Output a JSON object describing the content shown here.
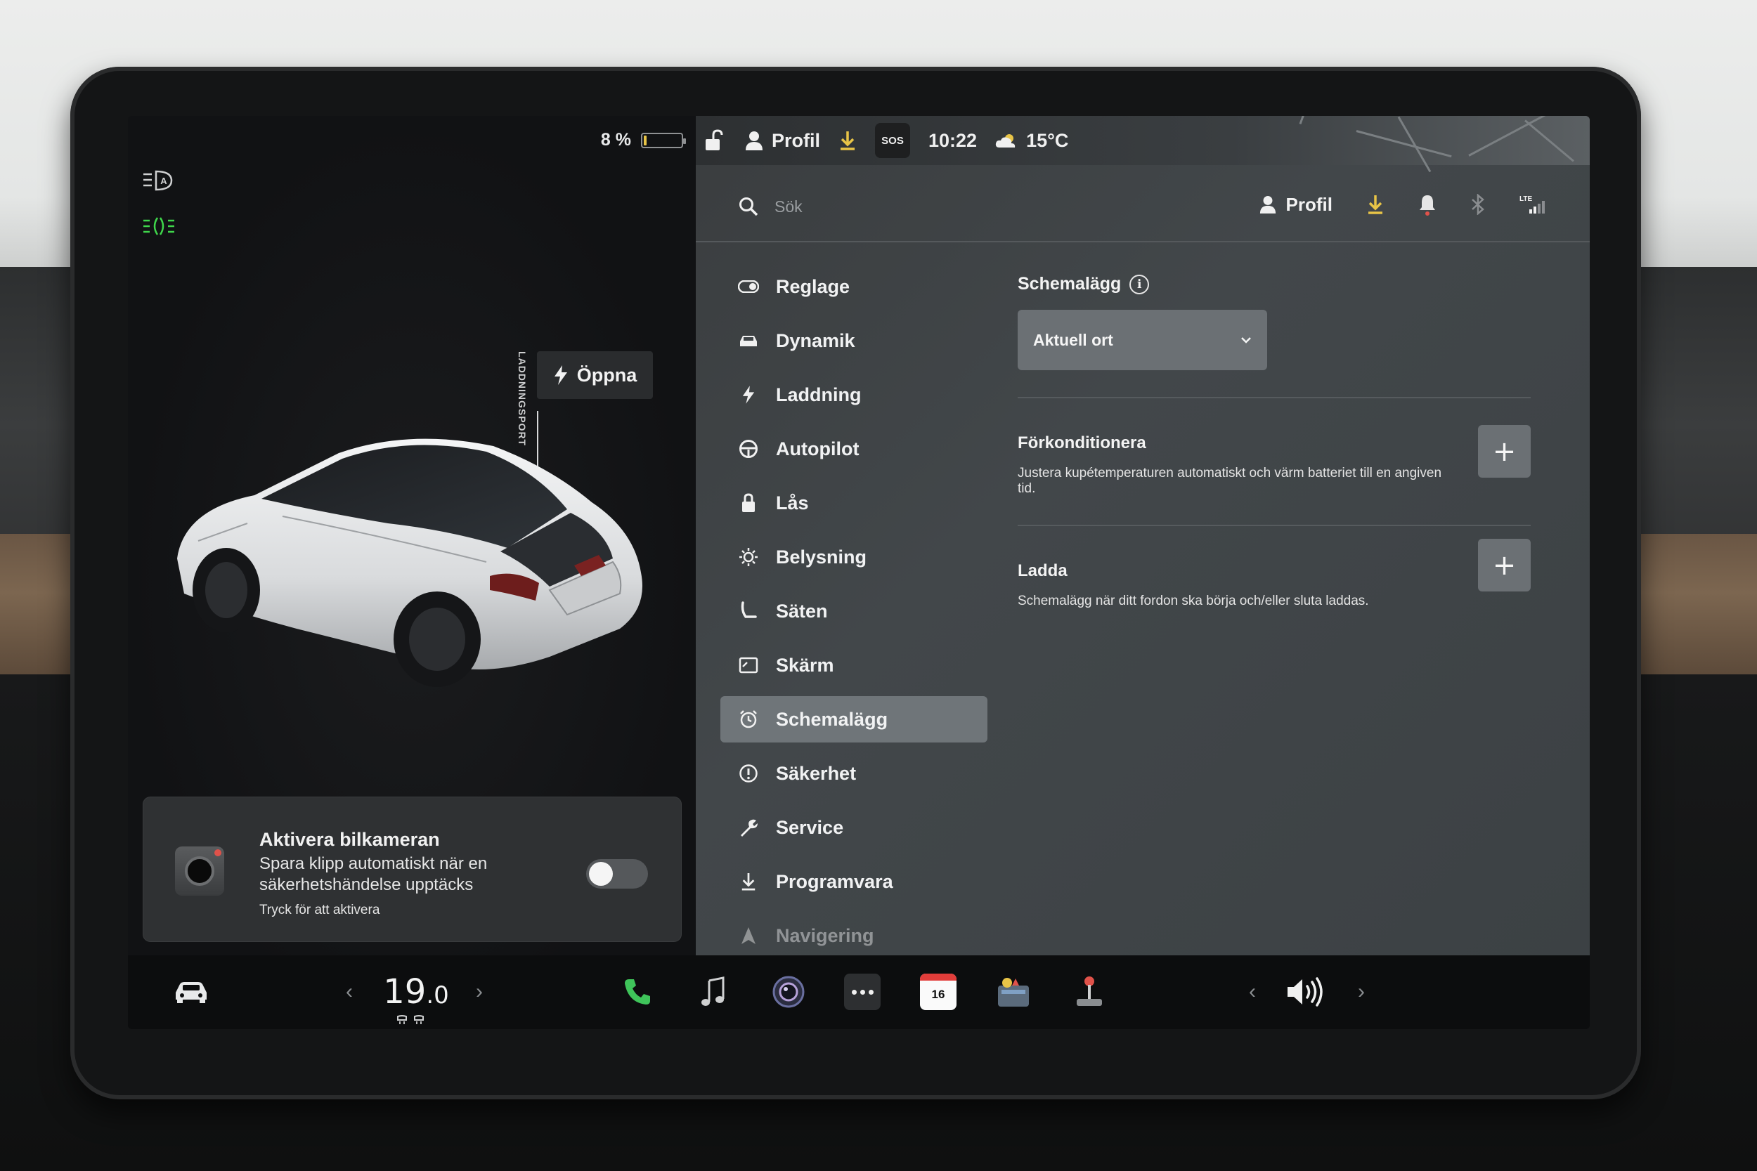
{
  "status": {
    "battery_percent_label": "8 %",
    "battery_level": 0.08,
    "profile_label": "Profil",
    "sos_label": "SOS",
    "time": "10:22",
    "temperature": "15°C"
  },
  "car_panel": {
    "charge_port_label": "LADDNINGSPORT",
    "open_button": "Öppna",
    "camera_card": {
      "title": "Aktivera bilkameran",
      "description": "Spara klipp automatiskt när en säkerhetshändelse upptäcks",
      "hint": "Tryck för att aktivera",
      "toggle_on": false
    }
  },
  "settings": {
    "search_placeholder": "Sök",
    "profile_label": "Profil",
    "menu": [
      {
        "label": "Reglage",
        "icon": "toggle-icon"
      },
      {
        "label": "Dynamik",
        "icon": "car-icon"
      },
      {
        "label": "Laddning",
        "icon": "bolt-icon"
      },
      {
        "label": "Autopilot",
        "icon": "steering-wheel-icon"
      },
      {
        "label": "Lås",
        "icon": "lock-icon"
      },
      {
        "label": "Belysning",
        "icon": "sun-icon"
      },
      {
        "label": "Säten",
        "icon": "seat-icon"
      },
      {
        "label": "Skärm",
        "icon": "display-icon"
      },
      {
        "label": "Schemalägg",
        "icon": "alarm-clock-icon",
        "active": true
      },
      {
        "label": "Säkerhet",
        "icon": "alert-circle-icon"
      },
      {
        "label": "Service",
        "icon": "wrench-icon"
      },
      {
        "label": "Programvara",
        "icon": "download-icon"
      },
      {
        "label": "Navigering",
        "icon": "navigation-icon"
      }
    ],
    "schedule": {
      "title": "Schemalägg",
      "location_select": "Aktuell ort",
      "precondition_title": "Förkonditionera",
      "precondition_desc": "Justera kupétemperaturen automatiskt och värm batteriet till en angiven tid.",
      "charge_title": "Ladda",
      "charge_desc": "Schemalägg när ditt fordon ska börja och/eller sluta laddas."
    }
  },
  "dock": {
    "temperature_int": "19",
    "temperature_dec": ".0",
    "calendar_day": "16"
  },
  "colors": {
    "accent_yellow": "#e8c447",
    "phone_green": "#3fc45a",
    "light_green": "#3fd64b"
  }
}
